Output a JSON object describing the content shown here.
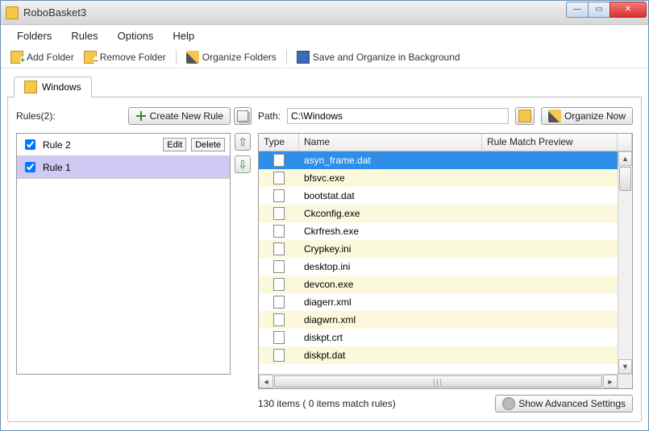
{
  "window": {
    "title": "RoboBasket3"
  },
  "menu": {
    "folders": "Folders",
    "rules": "Rules",
    "options": "Options",
    "help": "Help"
  },
  "toolbar": {
    "add_folder": "Add Folder",
    "remove_folder": "Remove Folder",
    "organize_folders": "Organize Folders",
    "save_bg": "Save and Organize in Background"
  },
  "tab": {
    "windows": "Windows"
  },
  "left": {
    "label": "Rules(2):",
    "create_new_rule": "Create New Rule",
    "edit": "Edit",
    "delete": "Delete",
    "rule1": "Rule 1",
    "rule2": "Rule 2"
  },
  "right": {
    "path_label": "Path:",
    "path_value": "C:\\Windows",
    "organize_now": "Organize Now",
    "headers": {
      "type": "Type",
      "name": "Name",
      "preview": "Rule Match Preview"
    },
    "files": [
      "asyn_frame.dat",
      "bfsvc.exe",
      "bootstat.dat",
      "Ckconfig.exe",
      "Ckrfresh.exe",
      "Crypkey.ini",
      "desktop.ini",
      "devcon.exe",
      "diagerr.xml",
      "diagwrn.xml",
      "diskpt.crt",
      "diskpt.dat"
    ],
    "status": "130 items ( 0 items match rules)",
    "advanced": "Show Advanced Settings"
  }
}
